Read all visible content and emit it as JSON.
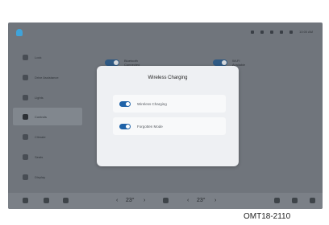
{
  "status_bar": {
    "logo_icon": "app-logo-icon",
    "time": "10:00 AM",
    "icons": [
      "bluetooth-icon",
      "wifi-icon",
      "signal-icon",
      "lte-icon",
      "settings-icon"
    ]
  },
  "sidebar": {
    "items": [
      {
        "label": "Lock",
        "icon": "lock-icon"
      },
      {
        "label": "Drive Assistance",
        "icon": "steering-assist-icon"
      },
      {
        "label": "Lights",
        "icon": "light-icon"
      },
      {
        "label": "Controls",
        "icon": "controls-icon",
        "active": true
      },
      {
        "label": "Climate",
        "icon": "fan-icon"
      },
      {
        "label": "Seats",
        "icon": "seat-icon"
      },
      {
        "label": "Display",
        "icon": "display-icon"
      }
    ]
  },
  "background_tiles": [
    {
      "label": "Bluetooth",
      "sublabel": "Connected"
    },
    {
      "label": "Wi-Fi",
      "sublabel": "Available"
    }
  ],
  "dialog": {
    "title": "Wireless Charging",
    "options": [
      {
        "label": "Wireless Charging",
        "enabled": true
      },
      {
        "label": "Forgotten Mode",
        "enabled": true
      }
    ]
  },
  "bottom_bar": {
    "left_temp": "23°",
    "right_temp": "23°",
    "icons": [
      "home-icon",
      "media-icon",
      "seat-heat-icon",
      "fan-icon",
      "music-icon",
      "navigation-icon",
      "apps-icon"
    ]
  },
  "figure_code": "OMT18-2110"
}
